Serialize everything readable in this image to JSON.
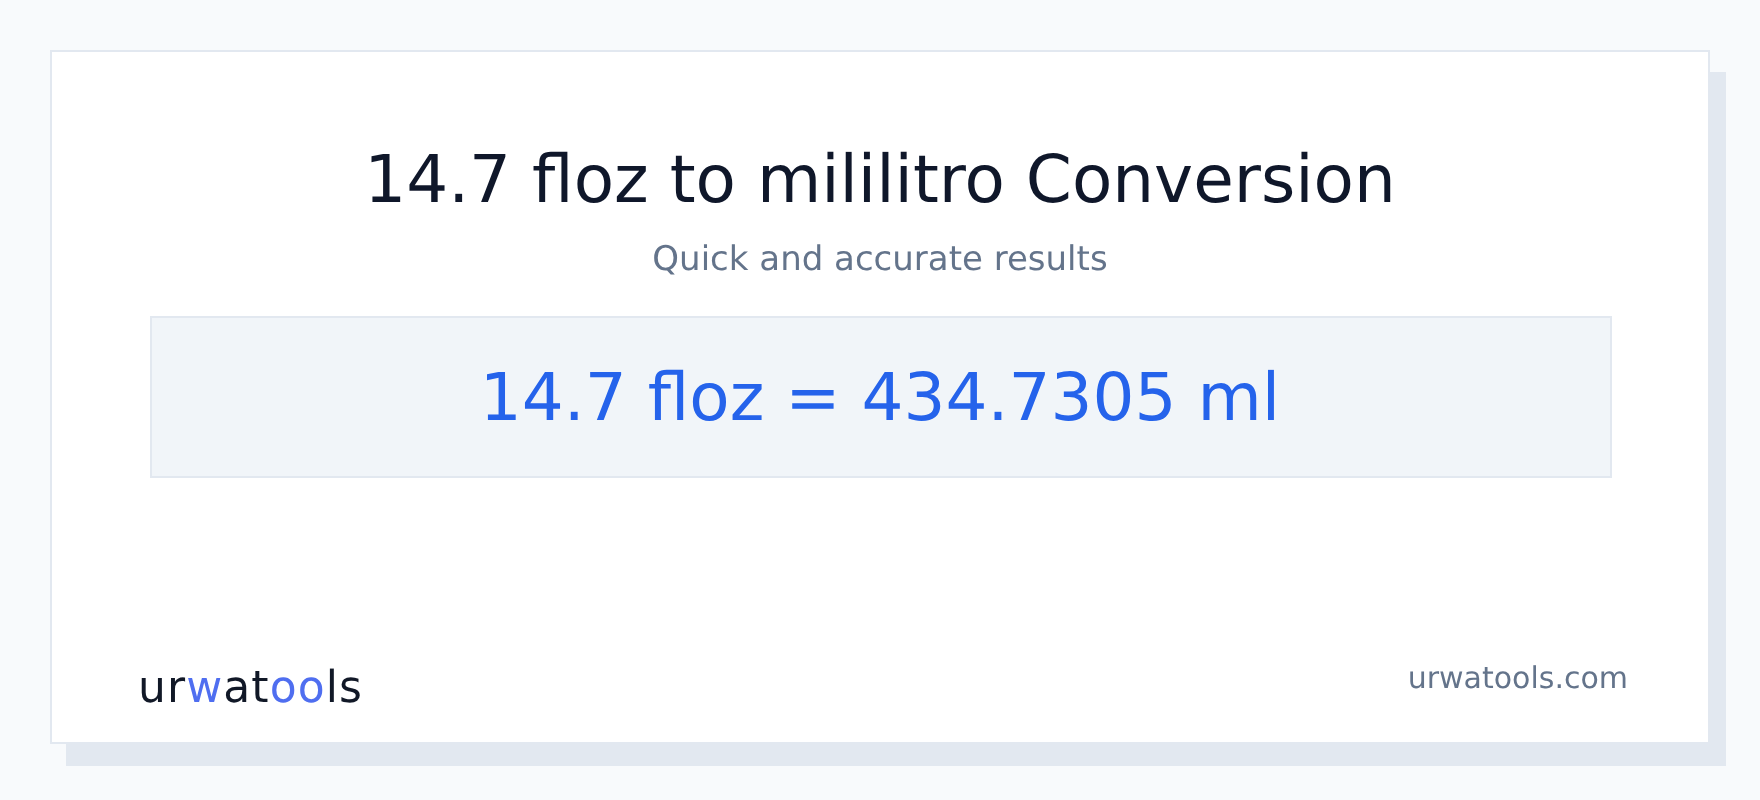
{
  "title": "14.7 floz to mililitro Conversion",
  "subtitle": "Quick and accurate results",
  "result": "14.7 floz = 434.7305 ml",
  "logo": [
    {
      "text": "ur",
      "accent": false
    },
    {
      "text": "w",
      "accent": true
    },
    {
      "text": "at",
      "accent": false
    },
    {
      "text": "oo",
      "accent": true
    },
    {
      "text": "ls",
      "accent": false
    }
  ],
  "site": "urwatools.com"
}
